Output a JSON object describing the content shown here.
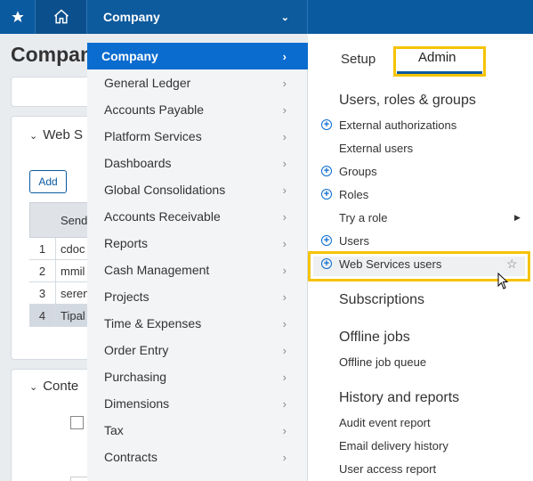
{
  "topbar": {
    "favorites_icon": "star-icon",
    "home_icon": "home-icon",
    "company_menu_label": "Company"
  },
  "background_page": {
    "title": "Compan",
    "web_services_section": "Web S",
    "add_button": "Add",
    "table_header": "Send",
    "rows": [
      {
        "num": "1",
        "value": "cdoc"
      },
      {
        "num": "2",
        "value": "mmil"
      },
      {
        "num": "3",
        "value": "seren"
      },
      {
        "num": "4",
        "value": "Tipal"
      }
    ],
    "content_section": "Conte"
  },
  "module_menu": {
    "items": [
      {
        "label": "Company"
      },
      {
        "label": "General Ledger"
      },
      {
        "label": "Accounts Payable"
      },
      {
        "label": "Platform Services"
      },
      {
        "label": "Dashboards"
      },
      {
        "label": "Global Consolidations"
      },
      {
        "label": "Accounts Receivable"
      },
      {
        "label": "Reports"
      },
      {
        "label": "Cash Management"
      },
      {
        "label": "Projects"
      },
      {
        "label": "Time & Expenses"
      },
      {
        "label": "Order Entry"
      },
      {
        "label": "Purchasing"
      },
      {
        "label": "Dimensions"
      },
      {
        "label": "Tax"
      },
      {
        "label": "Contracts"
      }
    ],
    "active_index": 0
  },
  "panel": {
    "tabs": {
      "setup": "Setup",
      "admin": "Admin"
    },
    "sections": {
      "users_roles": "Users, roles & groups",
      "subscriptions": "Subscriptions",
      "offline_jobs": "Offline jobs",
      "history": "History and reports"
    },
    "links": {
      "external_authorizations": "External authorizations",
      "external_users": "External users",
      "groups": "Groups",
      "roles": "Roles",
      "try_a_role": "Try a role",
      "users": "Users",
      "web_services_users": "Web Services users",
      "offline_job_queue": "Offline job queue",
      "audit_event_report": "Audit event report",
      "email_delivery_history": "Email delivery history",
      "user_access_report": "User access report"
    }
  },
  "colors": {
    "topbar": "#0a5aa0",
    "active_menu": "#0a6ccf",
    "highlight": "#f5c300"
  }
}
